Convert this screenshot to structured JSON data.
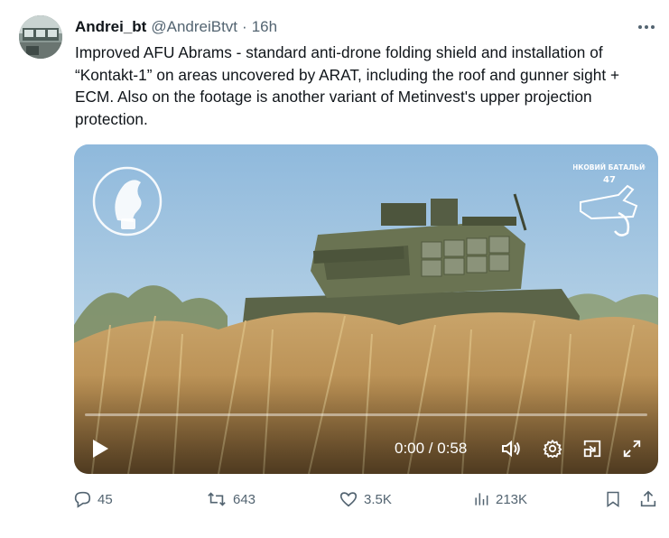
{
  "author": {
    "display_name": "Andrei_bt",
    "handle": "@AndreiBtvt",
    "separator": "·",
    "time": "16h"
  },
  "tweet": {
    "text": "Improved AFU Abrams - standard anti-drone folding shield and installation of “Kontakt-1” on areas uncovered by ARAT, including the roof and gunner sight + ECM. Also on the footage is another variant of Metinvest's upper projection protection."
  },
  "video": {
    "timecode": "0:00 / 0:58",
    "progress": 0,
    "watermark_right_text": "ТАНКОВИЙ БАТАЛЬЙОН",
    "watermark_right_number": "47"
  },
  "actions": {
    "replies": "45",
    "reposts": "643",
    "likes": "3.5K",
    "views": "213K"
  },
  "icons": {
    "more": "more-horizontal-icon",
    "play": "play-icon",
    "volume": "volume-icon",
    "settings": "gear-icon",
    "pip": "picture-in-picture-icon",
    "fullscreen": "fullscreen-icon",
    "reply": "reply-icon",
    "repost": "repost-icon",
    "like": "heart-icon",
    "views": "views-icon",
    "bookmark": "bookmark-icon",
    "share": "share-icon"
  },
  "colors": {
    "text_primary": "#0f1419",
    "text_secondary": "#536471"
  }
}
